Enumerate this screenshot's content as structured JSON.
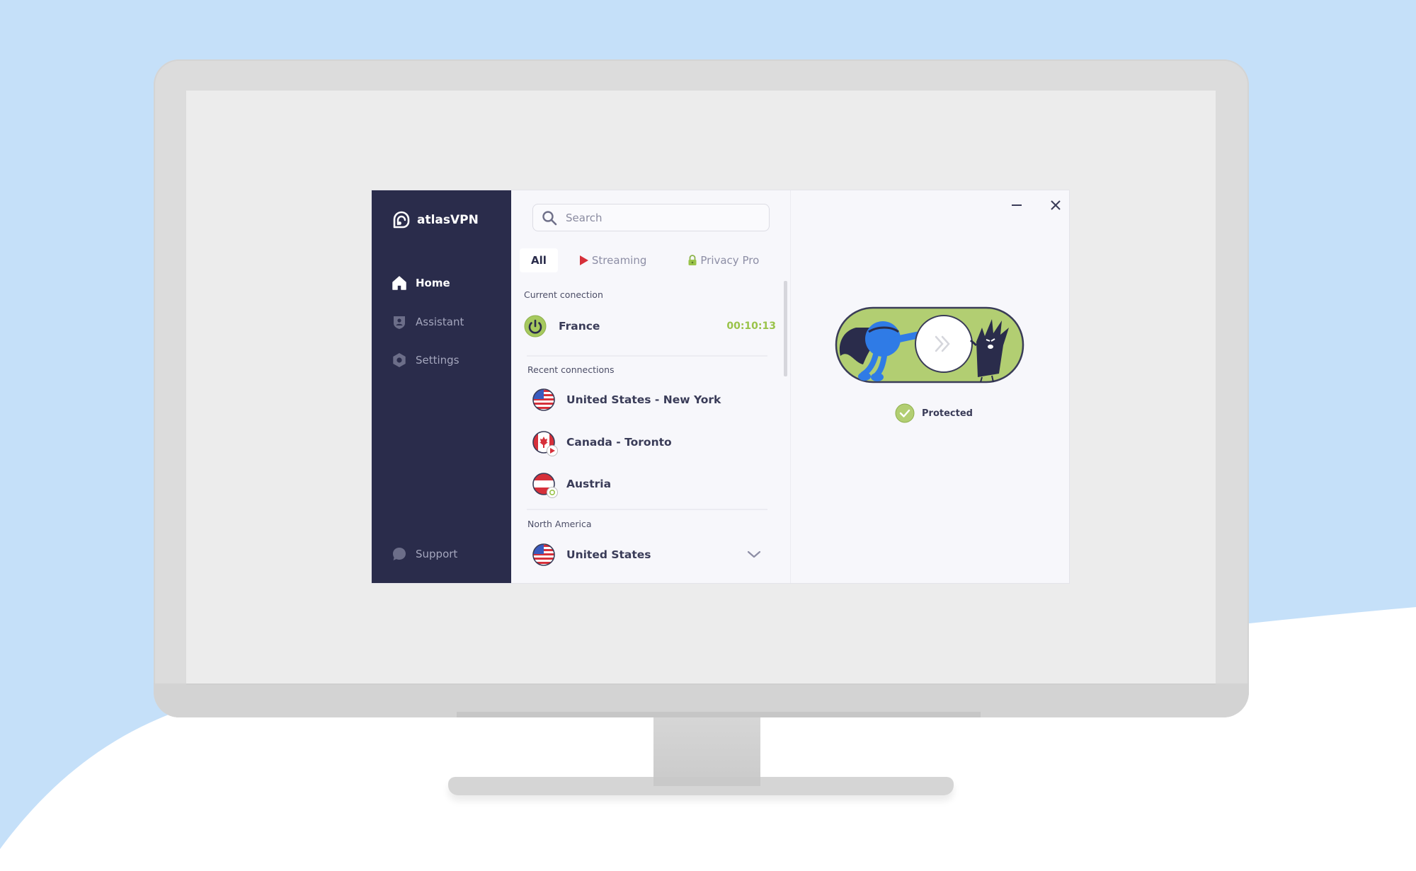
{
  "app": {
    "brand": "atlasVPN",
    "colors": {
      "sidebar_bg": "#2a2c4b",
      "accent_green": "#9ac34a",
      "toggle_green": "#b2ce72",
      "streaming_red": "#d6303a",
      "text_dark": "#3a3c58"
    }
  },
  "sidebar": {
    "items": [
      {
        "label": "Home",
        "icon": "home-icon",
        "active": true
      },
      {
        "label": "Assistant",
        "icon": "assistant-shield-icon",
        "active": false
      },
      {
        "label": "Settings",
        "icon": "gear-icon",
        "active": false
      }
    ],
    "support_label": "Support"
  },
  "search": {
    "placeholder": "Search",
    "value": ""
  },
  "tabs": [
    {
      "label": "All",
      "active": true
    },
    {
      "label": "Streaming",
      "icon": "play-icon",
      "active": false
    },
    {
      "label": "Privacy Pro",
      "icon": "lock-icon",
      "active": false
    }
  ],
  "current_connection": {
    "heading": "Current conection",
    "country": "France",
    "elapsed": "00:10:13"
  },
  "recent_connections": {
    "heading": "Recent connections",
    "items": [
      {
        "name": "United States - New York",
        "flag": "us",
        "badge": null
      },
      {
        "name": "Canada - Toronto",
        "flag": "ca",
        "badge": "streaming"
      },
      {
        "name": "Austria",
        "flag": "at",
        "badge": "refresh"
      }
    ]
  },
  "regions": [
    {
      "heading": "North America",
      "items": [
        {
          "name": "United States",
          "flag": "us",
          "expandable": true
        }
      ]
    }
  ],
  "window_controls": {
    "minimize": "−",
    "close": "✕"
  },
  "connection_status": {
    "label": "Protected",
    "connected": true
  }
}
